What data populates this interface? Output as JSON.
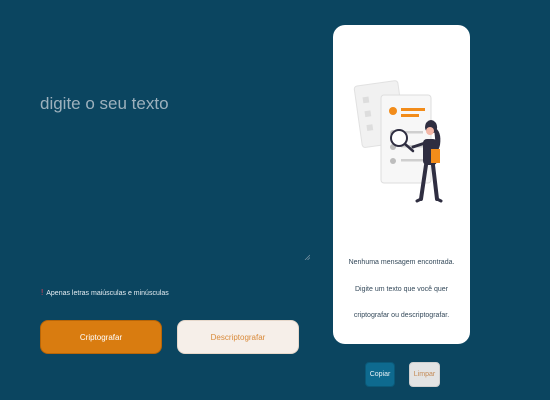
{
  "input": {
    "placeholder": "digite o seu texto",
    "hint_text": "Apenas letras maiúsculas e minúsculas"
  },
  "buttons": {
    "encrypt_label": "Criptografar",
    "decrypt_label": "Descriptografar",
    "copy_label": "Copiar",
    "clear_label": "Limpar"
  },
  "output_panel": {
    "title": "Nenhuma mensagem encontrada.",
    "line1": "Digite um texto que você quer",
    "line2": "criptografar ou descriptografar."
  },
  "icons": {
    "hint": "exclamation-icon",
    "illustration": "person-magnifier-illustration"
  },
  "colors": {
    "background": "#0b4560",
    "accent": "#d97c10",
    "secondary_button": "#f6efe9",
    "copy_button": "#0e6a8f",
    "clear_button": "#e3e3e3",
    "panel": "#ffffff"
  }
}
